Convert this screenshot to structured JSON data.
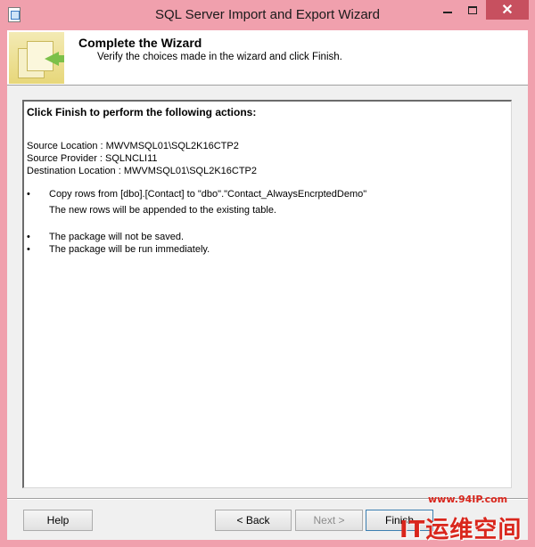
{
  "window": {
    "title": "SQL Server Import and Export Wizard",
    "close_glyph": "✕"
  },
  "header": {
    "title": "Complete the Wizard",
    "subtitle": "Verify the choices made in the wizard and click Finish."
  },
  "report": {
    "heading": "Click Finish to perform the following actions:",
    "source_location": "Source Location : MWVMSQL01\\SQL2K16CTP2",
    "source_provider": "Source Provider : SQLNCLI11",
    "destination_location": "Destination Location : MWVMSQL01\\SQL2K16CTP2",
    "bullet": "•",
    "actions": [
      {
        "text": "Copy rows from [dbo].[Contact] to \"dbo\".\"Contact_AlwaysEncrptedDemo\"",
        "detail": "The new rows will be appended to the existing table."
      },
      {
        "text": "The package will not be saved."
      },
      {
        "text": "The package will be run immediately."
      }
    ]
  },
  "buttons": {
    "help": "Help",
    "back": "< Back",
    "next": "Next >",
    "finish": "Finish"
  },
  "watermark": {
    "url": "www.94IP.com",
    "text": "IT运维空间"
  },
  "colors": {
    "titlebar": "#f0a0ad",
    "close_button": "#c7505f",
    "dialog_bg": "#f0f0f0",
    "watermark": "#d9261c"
  }
}
